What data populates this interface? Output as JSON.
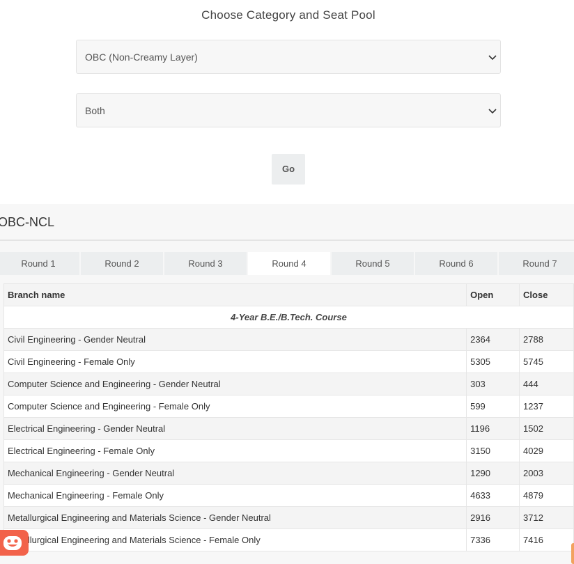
{
  "heading": "Choose Category and Seat Pool",
  "category_select": {
    "value": "OBC (Non-Creamy Layer)"
  },
  "seatpool_select": {
    "value": "Both"
  },
  "go_label": "Go",
  "panel": {
    "title": "OBC-NCL"
  },
  "tabs": [
    {
      "label": "Round 1",
      "active": false
    },
    {
      "label": "Round 2",
      "active": false
    },
    {
      "label": "Round 3",
      "active": false
    },
    {
      "label": "Round 4",
      "active": true
    },
    {
      "label": "Round 5",
      "active": false
    },
    {
      "label": "Round 6",
      "active": false
    },
    {
      "label": "Round 7",
      "active": false
    }
  ],
  "table": {
    "headers": {
      "branch": "Branch name",
      "open": "Open",
      "close": "Close"
    },
    "course": "4-Year B.E./B.Tech. Course",
    "rows": [
      {
        "branch": "Civil Engineering - Gender Neutral",
        "open": "2364",
        "close": "2788"
      },
      {
        "branch": "Civil Engineering - Female Only",
        "open": "5305",
        "close": "5745"
      },
      {
        "branch": "Computer Science and Engineering - Gender Neutral",
        "open": "303",
        "close": "444"
      },
      {
        "branch": "Computer Science and Engineering - Female Only",
        "open": "599",
        "close": "1237"
      },
      {
        "branch": "Electrical Engineering - Gender Neutral",
        "open": "1196",
        "close": "1502"
      },
      {
        "branch": "Electrical Engineering - Female Only",
        "open": "3150",
        "close": "4029"
      },
      {
        "branch": "Mechanical Engineering - Gender Neutral",
        "open": "1290",
        "close": "2003"
      },
      {
        "branch": "Mechanical Engineering - Female Only",
        "open": "4633",
        "close": "4879"
      },
      {
        "branch": "Metallurgical Engineering and Materials Science - Gender Neutral",
        "open": "2916",
        "close": "3712"
      },
      {
        "branch": "Metallurgical Engineering and Materials Science - Female Only",
        "open": "7336",
        "close": "7416"
      }
    ]
  },
  "icons": {
    "chevron": "chevron-down-icon",
    "chat": "chat-bot-icon"
  },
  "colors": {
    "chat_bubble": "#f2624a",
    "corner_tab": "#f2a25f"
  }
}
